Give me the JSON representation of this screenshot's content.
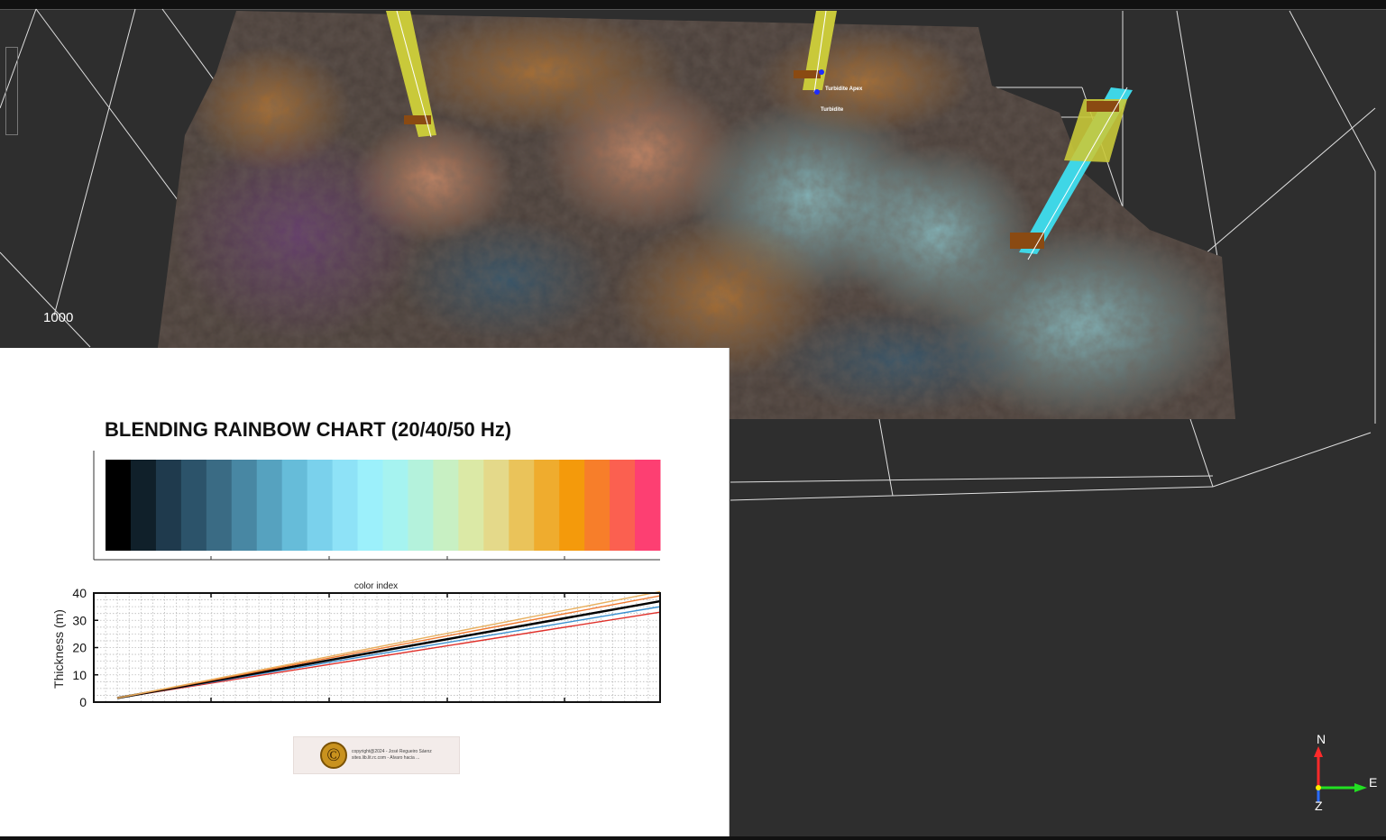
{
  "scene": {
    "depth_label": "1000",
    "wells": [
      {
        "label": "Turbidite Apex"
      },
      {
        "label": "Turbidite"
      }
    ],
    "colors": {
      "background": "#2e2e2e",
      "well_track_yellow": "#c9c93a",
      "well_track_cyan": "#3fd6e6",
      "well_marker_brown": "#8a4a12",
      "wireframe": "#ffffff"
    }
  },
  "chart_panel": {
    "title": "BLENDING RAINBOW CHART (20/40/50 Hz)",
    "colorbar_label": "color index",
    "colorbar_colors": [
      "#000000",
      "#10202a",
      "#1f3a4d",
      "#2c536a",
      "#3a6b84",
      "#4887a3",
      "#56a2bf",
      "#66bcd9",
      "#7ad1ec",
      "#8ee2f7",
      "#9cf0fb",
      "#a6f3f0",
      "#b4f2dc",
      "#c8f0c3",
      "#dbe9a6",
      "#e4d98a",
      "#eac35a",
      "#efac2e",
      "#f49a0b",
      "#f77e2a",
      "#fb6050",
      "#fd3f72"
    ],
    "copyright_line1": "copyright@2024 - José Regueiro Sáenz",
    "copyright_line2": "sites.lib.lit.rc.com - Alvaro hacia ...",
    "copyright_symbol": "©",
    "chart_data": {
      "type": "line",
      "ylabel": "Thickness (m)",
      "xlabel": "",
      "ylim": [
        0,
        40
      ],
      "yticks": [
        "0",
        "10",
        "20",
        "30",
        "40"
      ],
      "x": [
        0,
        1
      ],
      "series": [
        {
          "values": [
            1.5,
            33
          ],
          "color": "#e0302a"
        },
        {
          "values": [
            1.5,
            35
          ],
          "color": "#3a90d0"
        },
        {
          "values": [
            1.5,
            37
          ],
          "color": "#000000"
        },
        {
          "values": [
            1.5,
            39
          ],
          "color": "#f07a30"
        },
        {
          "values": [
            1.5,
            40.5
          ],
          "color": "#e8b060"
        }
      ],
      "grid": true
    }
  },
  "axis_widget": {
    "north": "N",
    "east": "E",
    "z": "Z",
    "colors": {
      "north": "#ff2a2a",
      "east": "#22e022",
      "z": "#2a6bff",
      "origin": "#ffee00"
    }
  }
}
